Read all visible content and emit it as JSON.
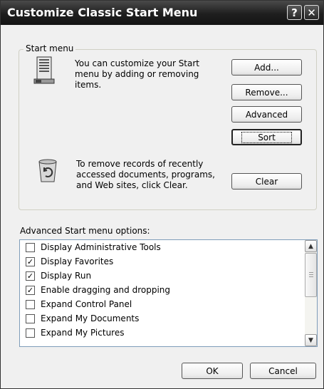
{
  "window": {
    "title": "Customize Classic Start Menu",
    "help_glyph": "?",
    "close_glyph": "✕"
  },
  "start_menu_group": {
    "legend": "Start menu",
    "customize_text": [
      "You can customize your Start",
      "menu by adding or removing",
      "items."
    ],
    "remove_records_text": [
      "To remove records of recently",
      "accessed documents, programs,",
      "and Web sites, click Clear."
    ],
    "buttons": {
      "add": "Add...",
      "remove": "Remove...",
      "advanced": "Advanced",
      "sort": "Sort",
      "clear": "Clear"
    }
  },
  "advanced_options": {
    "label": "Advanced Start menu options:",
    "items": [
      {
        "label": "Display Administrative Tools",
        "checked": false
      },
      {
        "label": "Display Favorites",
        "checked": true
      },
      {
        "label": "Display Run",
        "checked": true
      },
      {
        "label": "Enable dragging and dropping",
        "checked": true
      },
      {
        "label": "Expand Control Panel",
        "checked": false
      },
      {
        "label": "Expand My Documents",
        "checked": false
      },
      {
        "label": "Expand My Pictures",
        "checked": false
      }
    ]
  },
  "footer": {
    "ok": "OK",
    "cancel": "Cancel"
  }
}
